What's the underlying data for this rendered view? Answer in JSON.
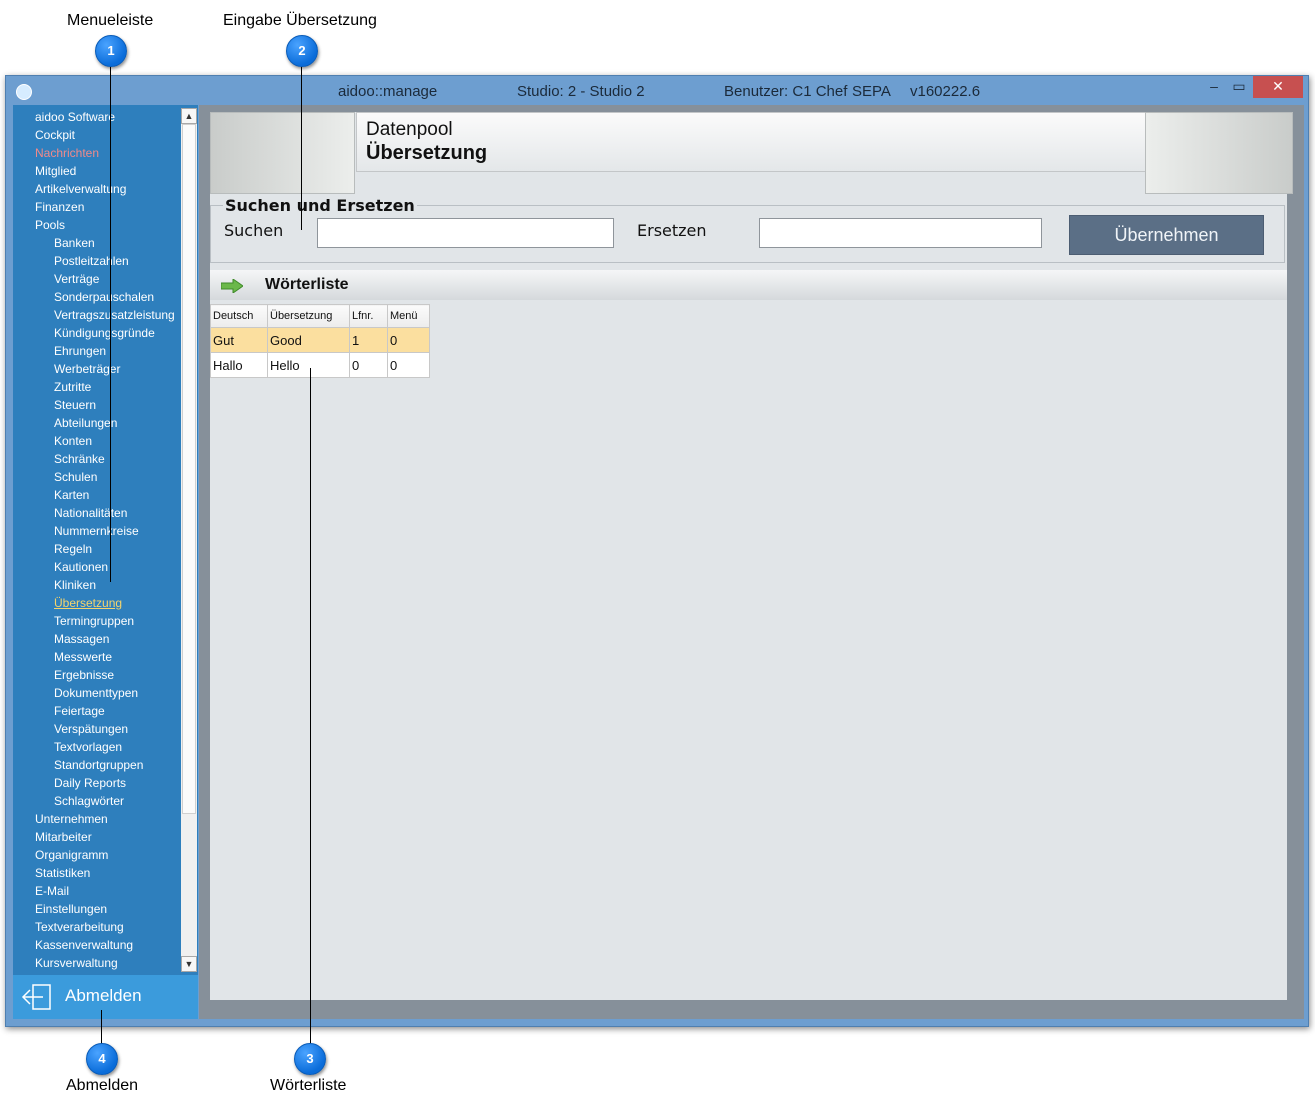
{
  "callouts": [
    {
      "number": "1",
      "label": "Menueleiste"
    },
    {
      "number": "2",
      "label": "Eingabe Übersetzung"
    },
    {
      "number": "3",
      "label": "Wörterliste"
    },
    {
      "number": "4",
      "label": "Abmelden"
    }
  ],
  "window": {
    "app_name": "aidoo::manage",
    "studio": "Studio: 2 - Studio 2",
    "user": "Benutzer: C1 Chef",
    "sepa": "SEPA",
    "version": "v160222.6",
    "minimize_glyph": "–",
    "maximize_glyph": "▭",
    "close_glyph": "✕"
  },
  "sidebar": {
    "items": [
      {
        "label": "aidoo Software",
        "level": 1
      },
      {
        "label": "Cockpit",
        "level": 1
      },
      {
        "label": "Nachrichten",
        "level": 1,
        "color": "#f08a8a"
      },
      {
        "label": "Mitglied",
        "level": 1
      },
      {
        "label": "Artikelverwaltung",
        "level": 1
      },
      {
        "label": "Finanzen",
        "level": 1
      },
      {
        "label": "Pools",
        "level": 1
      },
      {
        "label": "Banken",
        "level": 2
      },
      {
        "label": "Postleitzahlen",
        "level": 2
      },
      {
        "label": "Verträge",
        "level": 2
      },
      {
        "label": "Sonderpauschalen",
        "level": 2
      },
      {
        "label": "Vertragszusatzleistung",
        "level": 2
      },
      {
        "label": "Kündigungsgründe",
        "level": 2
      },
      {
        "label": "Ehrungen",
        "level": 2
      },
      {
        "label": "Werbeträger",
        "level": 2
      },
      {
        "label": "Zutritte",
        "level": 2
      },
      {
        "label": "Steuern",
        "level": 2
      },
      {
        "label": "Abteilungen",
        "level": 2
      },
      {
        "label": "Konten",
        "level": 2
      },
      {
        "label": "Schränke",
        "level": 2
      },
      {
        "label": "Schulen",
        "level": 2
      },
      {
        "label": "Karten",
        "level": 2
      },
      {
        "label": "Nationalitäten",
        "level": 2
      },
      {
        "label": "Nummernkreise",
        "level": 2
      },
      {
        "label": "Regeln",
        "level": 2
      },
      {
        "label": "Kautionen",
        "level": 2
      },
      {
        "label": "Kliniken",
        "level": 2
      },
      {
        "label": "Übersetzung",
        "level": 2,
        "active": true,
        "color": "#f4d46c"
      },
      {
        "label": "Termingruppen",
        "level": 2
      },
      {
        "label": "Massagen",
        "level": 2
      },
      {
        "label": "Messwerte",
        "level": 2
      },
      {
        "label": "Ergebnisse",
        "level": 2
      },
      {
        "label": "Dokumenttypen",
        "level": 2
      },
      {
        "label": "Feiertage",
        "level": 2
      },
      {
        "label": "Verspätungen",
        "level": 2
      },
      {
        "label": "Textvorlagen",
        "level": 2
      },
      {
        "label": "Standortgruppen",
        "level": 2
      },
      {
        "label": "Daily Reports",
        "level": 2
      },
      {
        "label": "Schlagwörter",
        "level": 2
      },
      {
        "label": "Unternehmen",
        "level": 1
      },
      {
        "label": "Mitarbeiter",
        "level": 1
      },
      {
        "label": "Organigramm",
        "level": 1
      },
      {
        "label": "Statistiken",
        "level": 1
      },
      {
        "label": "E-Mail",
        "level": 1
      },
      {
        "label": "Einstellungen",
        "level": 1
      },
      {
        "label": "Textverarbeitung",
        "level": 1
      },
      {
        "label": "Kassenverwaltung",
        "level": 1
      },
      {
        "label": "Kursverwaltung",
        "level": 1
      }
    ],
    "scroll_up_glyph": "▲",
    "scroll_down_glyph": "▼",
    "logout_label": "Abmelden",
    "logout_icon": "logout-arrow-icon",
    "color_background": "#2e7fbd",
    "color_logout": "#3b9bdc"
  },
  "header": {
    "line1": "Datenpool",
    "line2": "Übersetzung"
  },
  "search": {
    "legend": "Suchen und Ersetzen",
    "search_label": "Suchen",
    "search_value": "",
    "replace_label": "Ersetzen",
    "replace_value": "",
    "apply_label": "Übernehmen"
  },
  "word_list": {
    "title": "Wörterliste",
    "icon": "green-arrow-icon",
    "columns": [
      "Deutsch",
      "Übersetzung",
      "Lfnr.",
      "Menü"
    ],
    "rows": [
      [
        "Gut",
        "Good",
        "1",
        "0"
      ],
      [
        "Hallo",
        "Hello",
        "0",
        "0"
      ]
    ],
    "selected_row": 0,
    "color_selected": "#fbdf9f"
  }
}
